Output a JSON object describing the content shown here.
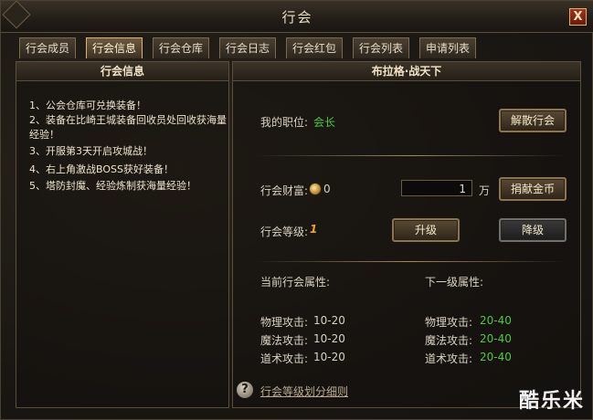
{
  "window": {
    "title": "行会",
    "close_glyph": "X"
  },
  "tabs": [
    {
      "label": "行会成员"
    },
    {
      "label": "行会信息",
      "active": true
    },
    {
      "label": "行会仓库"
    },
    {
      "label": "行会日志"
    },
    {
      "label": "行会红包"
    },
    {
      "label": "行会列表"
    },
    {
      "label": "申请列表"
    }
  ],
  "left_panel": {
    "title": "行会信息",
    "notices": [
      "1、公会仓库可兑换装备！",
      "2、装备在比崎王城装备回收员处回收获海量经验！",
      "3、开服第3天开启攻城战！",
      "4、右上角激战BOSS获好装备！",
      "5、塔防封魔、经验炼制获海量经验！"
    ]
  },
  "right_panel": {
    "title": "布拉格·战天下",
    "position_label": "我的职位:",
    "position_value": "会长",
    "disband_button": "解散行会",
    "wealth_label": "行会财富:",
    "wealth_value": "0",
    "donate_input_value": "1",
    "donate_unit": "万",
    "donate_button": "捐献金币",
    "level_label": "行会等级:",
    "level_value": "1",
    "upgrade_button": "升级",
    "downgrade_button": "降级",
    "current_attr_title": "当前行会属性:",
    "next_attr_title": "下一级属性:",
    "current_attrs": [
      {
        "label": "物理攻击:",
        "value": "10-20"
      },
      {
        "label": "魔法攻击:",
        "value": "10-20"
      },
      {
        "label": "道术攻击:",
        "value": "10-20"
      }
    ],
    "next_attrs": [
      {
        "label": "物理攻击:",
        "value": "20-40"
      },
      {
        "label": "魔法攻击:",
        "value": "20-40"
      },
      {
        "label": "道术攻击:",
        "value": "20-40"
      }
    ],
    "help_glyph": "?",
    "help_link": "行会等级划分细则"
  },
  "watermark": "酷乐米",
  "colors": {
    "accent_green": "#4fc93a",
    "gold_border": "#d9b573"
  }
}
